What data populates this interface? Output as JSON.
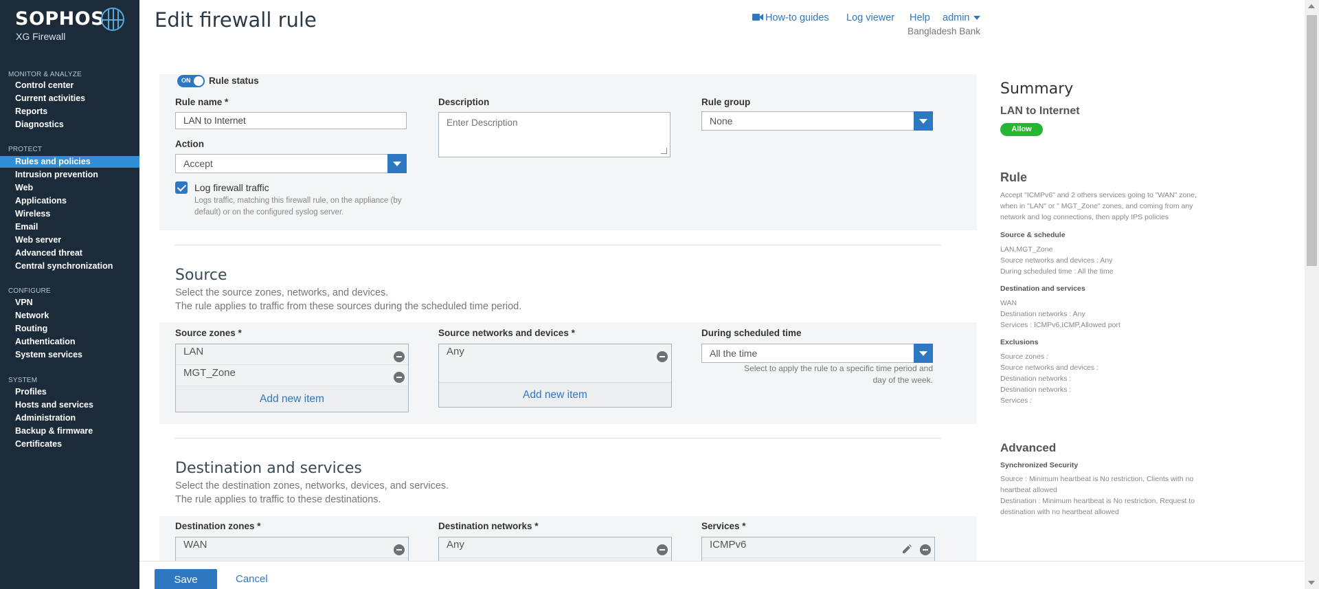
{
  "sidebar": {
    "logo": "SOPHOS",
    "product": "XG Firewall",
    "sections": [
      {
        "title": "MONITOR & ANALYZE",
        "items": [
          "Control center",
          "Current activities",
          "Reports",
          "Diagnostics"
        ]
      },
      {
        "title": "PROTECT",
        "items": [
          "Rules and policies",
          "Intrusion prevention",
          "Web",
          "Applications",
          "Wireless",
          "Email",
          "Web server",
          "Advanced threat",
          "Central synchronization"
        ]
      },
      {
        "title": "CONFIGURE",
        "items": [
          "VPN",
          "Network",
          "Routing",
          "Authentication",
          "System services"
        ]
      },
      {
        "title": "SYSTEM",
        "items": [
          "Profiles",
          "Hosts and services",
          "Administration",
          "Backup & firmware",
          "Certificates"
        ]
      }
    ],
    "active_item": "Rules and policies"
  },
  "header": {
    "title": "Edit firewall rule",
    "links": {
      "howto": "How-to guides",
      "logviewer": "Log viewer",
      "help": "Help",
      "admin": "admin"
    },
    "organization": "Bangladesh Bank"
  },
  "form": {
    "rule_status_toggle": "ON",
    "rule_status_label": "Rule status",
    "rule_name_label": "Rule name *",
    "rule_name_value": "LAN to Internet",
    "description_label": "Description",
    "description_placeholder": "Enter Description",
    "rule_group_label": "Rule group",
    "rule_group_value": "None",
    "action_label": "Action",
    "action_value": "Accept",
    "log_traffic_label": "Log firewall traffic",
    "log_traffic_checked": true,
    "log_traffic_help_1": "Logs traffic, matching this firewall rule, on the appliance (by",
    "log_traffic_help_2": "default) or on the configured syslog server."
  },
  "source": {
    "title": "Source",
    "desc_1": "Select the source zones, networks, and devices.",
    "desc_2": "The rule applies to traffic from these sources during the scheduled time period.",
    "zones_label": "Source zones *",
    "zones": [
      "LAN",
      "MGT_Zone"
    ],
    "networks_label": "Source networks and devices *",
    "networks": [
      "Any"
    ],
    "add_new": "Add new item",
    "schedule_label": "During scheduled time",
    "schedule_value": "All the time",
    "schedule_help_1": "Select to apply the rule to a specific time period and",
    "schedule_help_2": "day of the week."
  },
  "destination": {
    "title": "Destination and services",
    "desc_1": "Select the destination zones, networks, devices, and services.",
    "desc_2": "The rule applies to traffic to these destinations.",
    "zones_label": "Destination zones *",
    "zones": [
      "WAN"
    ],
    "networks_label": "Destination networks *",
    "networks": [
      "Any"
    ],
    "services_label": "Services *",
    "services": [
      "ICMPv6"
    ]
  },
  "summary": {
    "title": "Summary",
    "rule_name": "LAN to Internet",
    "badge": "Allow",
    "rule_heading": "Rule",
    "rule_text_1": "Accept \"ICMPv6\" and 2 others services going to \"WAN\" zone,",
    "rule_text_2": "when in \"LAN\" or \" MGT_Zone\" zones, and coming from any",
    "rule_text_3": "network and log connections, then apply IPS policies",
    "src_sched_heading": "Source & schedule",
    "src_sched_lines": [
      "LAN,MGT_Zone",
      "Source networks and devices : Any",
      "During scheduled time : All the time"
    ],
    "dest_heading": "Destination and services",
    "dest_lines": [
      "WAN",
      "Destination networks : Any",
      "Services : ICMPv6,ICMP,Allowed port"
    ],
    "excl_heading": "Exclusions",
    "excl_lines": [
      "Source zones :",
      "Source networks and devices :",
      "Destination networks :",
      "Destination networks :",
      "Services :"
    ],
    "advanced_heading": "Advanced",
    "sync_heading": "Synchronized Security",
    "sync_lines": [
      "Source : Minimum heartbeat is No restriction, Clients with no",
      "heartbeat allowed",
      "Destination : Minimum heartbeat is No restriction, Request to",
      "destination with no heartbeat allowed"
    ]
  },
  "footer": {
    "save": "Save",
    "cancel": "Cancel"
  },
  "colors": {
    "accent": "#2e78c2",
    "sidebar": "#1c2b3a",
    "active_nav": "#2e8fd8",
    "allow_badge": "#27b534"
  }
}
